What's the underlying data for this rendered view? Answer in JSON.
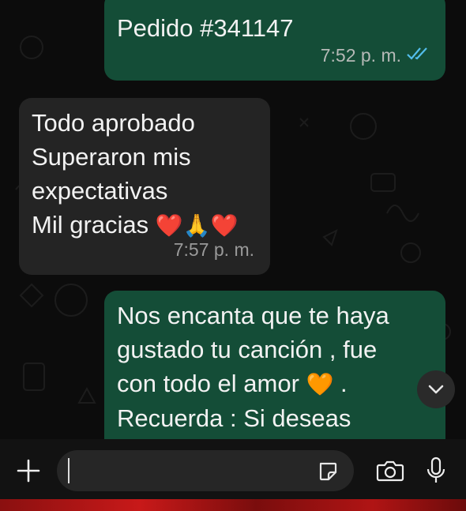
{
  "messages": [
    {
      "direction": "out",
      "lines": [
        "Pedido #341147"
      ],
      "time": "7:52 p. m.",
      "status_icon": "double-check-icon",
      "status_color": "#53bdeb"
    },
    {
      "direction": "in",
      "lines": [
        "Todo aprobado",
        "Superaron mis",
        "expectativas",
        "Mil gracias"
      ],
      "emoji_last_line": "❤️🙏❤️",
      "time": "7:57 p. m."
    },
    {
      "direction": "out",
      "lines": [
        "Nos encanta que te haya",
        "gustado tu canción , fue",
        "con todo el amor",
        "Recuerda : Si deseas"
      ],
      "emoji_third_line": "🧡",
      "punct_third_line": "."
    }
  ],
  "composer": {
    "placeholder": ""
  },
  "icons": {
    "attach": "plus-icon",
    "sticker": "sticker-icon",
    "camera": "camera-icon",
    "mic": "microphone-icon",
    "scroll": "chevron-down-icon"
  },
  "colors": {
    "outgoing_bubble": "#144d37",
    "incoming_bubble": "#242424",
    "read_ticks": "#53bdeb"
  }
}
